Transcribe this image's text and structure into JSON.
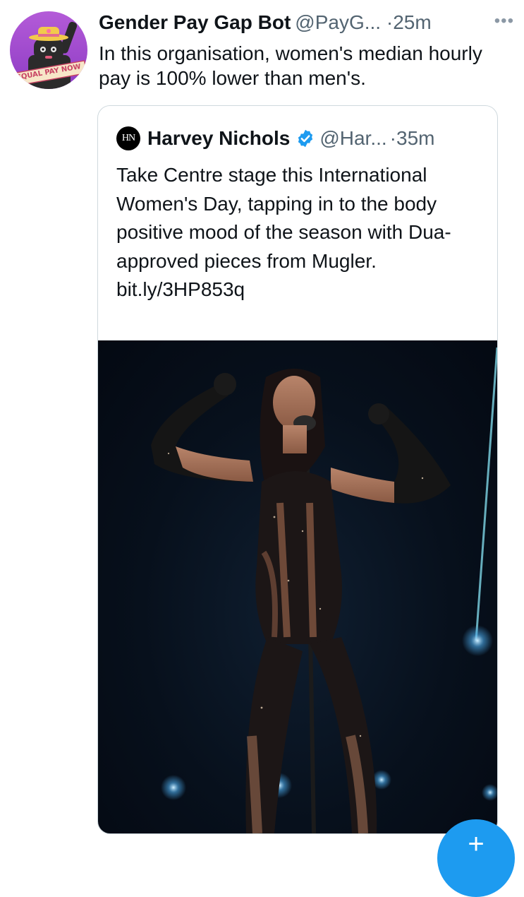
{
  "tweet": {
    "display_name": "Gender Pay Gap Bot",
    "handle": "@PayG...",
    "separator": "·",
    "time": "25m",
    "more_icon": "more-dots-icon",
    "text": "In this organisation, women's median hourly pay is 100% lower than men's.",
    "avatar_badge_text": "EQUAL PAY NOW"
  },
  "quote": {
    "avatar_text": "HN",
    "display_name": "Harvey Nichols",
    "verified_icon": "verified-badge-icon",
    "handle": "@Har...",
    "separator": "·",
    "time": "35m",
    "text": "Take Centre stage this International Women's Day, tapping in to the body positive mood of the season with Dua-approved pieces from Mugler.",
    "link": "bit.ly/3HP853q",
    "media_description_icon": "stage-performer-photo"
  },
  "compose_button": {
    "icon": "plus-icon",
    "label": "+"
  },
  "colors": {
    "text_primary": "#0f1419",
    "text_secondary": "#536471",
    "border": "#cfd9de",
    "accent": "#1d9bf0"
  }
}
